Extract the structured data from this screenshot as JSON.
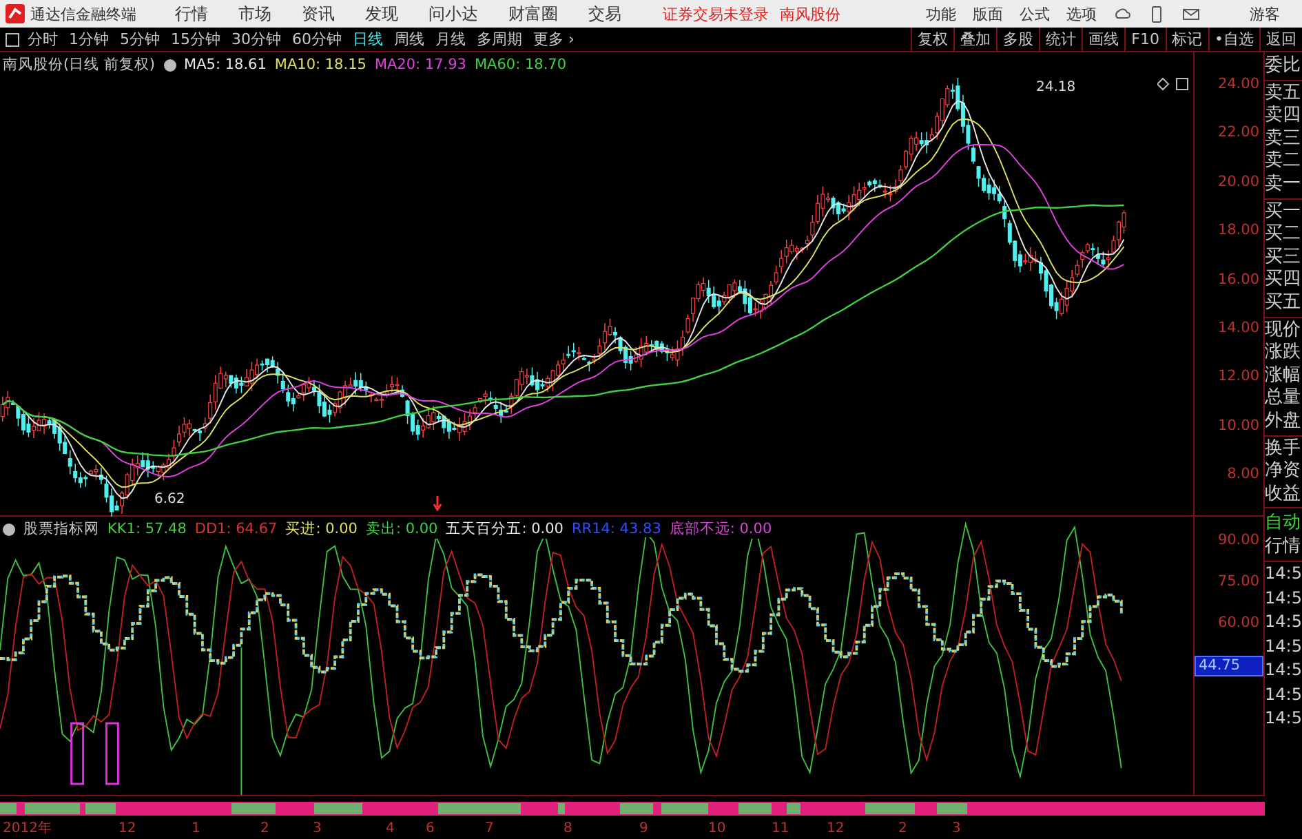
{
  "title_bar": {
    "app_name": "通达信金融终端",
    "menus": [
      "行情",
      "市场",
      "资讯",
      "发现",
      "问小达",
      "财富圈",
      "交易"
    ],
    "login_status": "证券交易未登录",
    "stock_name": "南风股份",
    "tools": [
      "功能",
      "版面",
      "公式",
      "选项"
    ],
    "user": "游客"
  },
  "toolbar": {
    "periods": [
      {
        "label": "分时",
        "selected": false
      },
      {
        "label": "1分钟",
        "selected": false
      },
      {
        "label": "5分钟",
        "selected": false
      },
      {
        "label": "15分钟",
        "selected": false
      },
      {
        "label": "30分钟",
        "selected": false
      },
      {
        "label": "60分钟",
        "selected": false
      },
      {
        "label": "日线",
        "selected": true
      },
      {
        "label": "周线",
        "selected": false
      },
      {
        "label": "月线",
        "selected": false
      },
      {
        "label": "多周期",
        "selected": false
      }
    ],
    "more": "更多",
    "more_chevron": "›",
    "actions": [
      "复权",
      "叠加",
      "多股",
      "统计",
      "画线",
      "F10",
      "标记",
      "•自选",
      "返回"
    ]
  },
  "price_chart": {
    "title": "南风股份(日线 前复权)",
    "indicators": [
      {
        "text": "MA5: 18.61",
        "color": "#e8e8e8"
      },
      {
        "text": "MA10: 18.15",
        "color": "#e0e060"
      },
      {
        "text": "MA20: 17.93",
        "color": "#e040e0"
      },
      {
        "text": "MA60: 18.70",
        "color": "#40d040"
      }
    ],
    "y_ticks": [
      "24.00",
      "22.00",
      "20.00",
      "18.00",
      "16.00",
      "14.00",
      "12.00",
      "10.00",
      "8.00"
    ],
    "high_label": "24.18",
    "low_label": "6.62"
  },
  "indicator_chart": {
    "title": "股票指标网",
    "values": [
      {
        "text": "KK1: 57.48",
        "color": "#40d040"
      },
      {
        "text": "DD1: 64.67",
        "color": "#e03030"
      },
      {
        "text": "买进: 0.00",
        "color": "#e0e060"
      },
      {
        "text": "卖出: 0.00",
        "color": "#40d040"
      },
      {
        "text": "五天百分五: 0.00",
        "color": "#e8e8e8"
      },
      {
        "text": "RR14: 43.83",
        "color": "#3050ff"
      },
      {
        "text": "底部不远: 0.00",
        "color": "#e040e0"
      }
    ],
    "y_ticks": [
      "90.00",
      "75.00",
      "60.00"
    ],
    "current_value": "44.75"
  },
  "date_axis": [
    "2012年",
    "12",
    "1",
    "2",
    "3",
    "4",
    "6",
    "7",
    "8",
    "9",
    "10",
    "11",
    "12",
    "2",
    "3"
  ],
  "side_panel": {
    "quote_groups": [
      [
        "委比"
      ],
      [
        "卖五",
        "卖四",
        "卖三",
        "卖二",
        "卖一"
      ],
      [
        "买一",
        "买二",
        "买三",
        "买四",
        "买五"
      ],
      [
        "现价",
        "涨跌",
        "涨幅",
        "总量",
        "外盘"
      ],
      [
        "换手",
        "净资",
        "收益"
      ]
    ],
    "tabs": [
      "自动",
      "行情"
    ],
    "times": [
      "14:5",
      "14:5",
      "14:5",
      "14:5",
      "14:5",
      "14:5",
      "14:5"
    ]
  }
}
